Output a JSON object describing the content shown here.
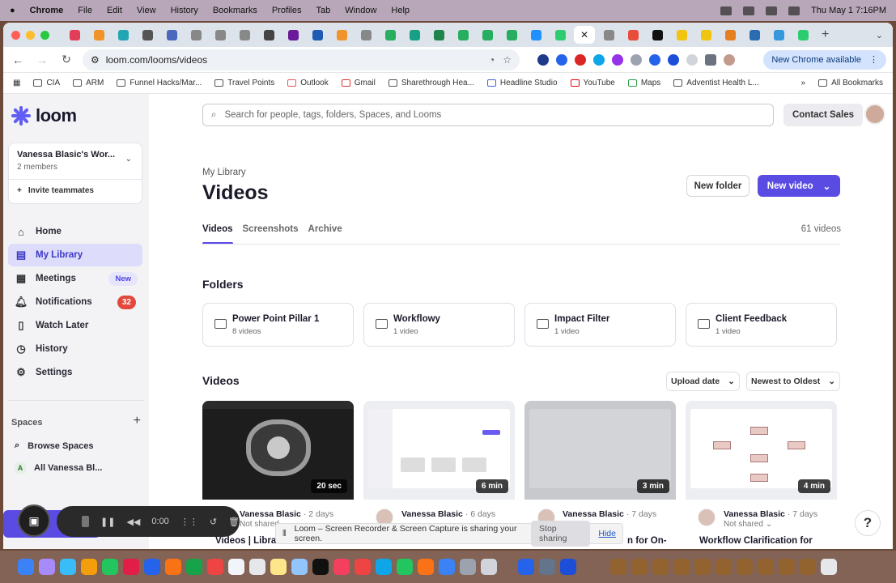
{
  "menubar": {
    "app": "Chrome",
    "items": [
      "File",
      "Edit",
      "View",
      "History",
      "Bookmarks",
      "Profiles",
      "Tab",
      "Window",
      "Help"
    ],
    "clock": "Thu May 1  7:16PM"
  },
  "browser": {
    "url": "loom.com/looms/videos",
    "new_chrome_label": "New Chrome available",
    "bookmarks": [
      "CIA",
      "ARM",
      "Funnel Hacks/Mar...",
      "Travel Points",
      "Outlook",
      "Gmail",
      "Sharethrough Hea...",
      "Headline Studio",
      "YouTube",
      "Maps",
      "Adventist Health L..."
    ],
    "all_bookmarks": "All Bookmarks"
  },
  "sidebar": {
    "logo": "loom",
    "workspace_name": "Vanessa Blasic's Wor...",
    "workspace_members": "2 members",
    "invite_label": "Invite teammates",
    "nav": [
      {
        "label": "Home",
        "icon": "home-icon"
      },
      {
        "label": "My Library",
        "icon": "library-icon"
      },
      {
        "label": "Meetings",
        "icon": "calendar-icon",
        "badge": "New"
      },
      {
        "label": "Notifications",
        "icon": "bell-icon",
        "count": "32"
      },
      {
        "label": "Watch Later",
        "icon": "bookmark-icon"
      },
      {
        "label": "History",
        "icon": "clock-icon"
      },
      {
        "label": "Settings",
        "icon": "gear-icon"
      }
    ],
    "spaces_title": "Spaces",
    "browse_spaces": "Browse Spaces",
    "space_item": "All Vanessa Bl...",
    "space_letter": "A"
  },
  "header": {
    "search_placeholder": "Search for people, tags, folders, Spaces, and Looms",
    "contact_sales": "Contact Sales"
  },
  "page": {
    "breadcrumb": "My Library",
    "title": "Videos",
    "new_folder": "New folder",
    "new_video": "New video",
    "tabs": [
      "Videos",
      "Screenshots",
      "Archive"
    ],
    "video_count": "61 videos",
    "folders_title": "Folders",
    "videos_title": "Videos",
    "sort_upload": "Upload date",
    "sort_order": "Newest to Oldest"
  },
  "folders": [
    {
      "name": "Power Point Pillar 1",
      "count": "8 videos"
    },
    {
      "name": "Workflowy",
      "count": "1 video"
    },
    {
      "name": "Impact Filter",
      "count": "1 video"
    },
    {
      "name": "Client Feedback",
      "count": "1 video"
    }
  ],
  "videos": [
    {
      "duration": "20 sec",
      "author": "Vanessa Blasic",
      "date": "· 2 days",
      "sharing": "Not shared",
      "title": "Videos | Librar"
    },
    {
      "duration": "6 min",
      "author": "Vanessa Blasic",
      "date": "· 6 days",
      "sharing": "",
      "title": ""
    },
    {
      "duration": "3 min",
      "author": "Vanessa Blasic",
      "date": "· 7 days",
      "sharing": "",
      "title": "n for On-"
    },
    {
      "duration": "4 min",
      "author": "Vanessa Blasic",
      "date": "· 7 days",
      "sharing": "Not shared ⌄",
      "title": "Workflow Clarification for"
    }
  ],
  "recorder": {
    "timer": "0:00"
  },
  "share_notice": {
    "text": "Loom – Screen Recorder & Screen Capture is sharing your screen.",
    "stop": "Stop sharing",
    "hide": "Hide"
  },
  "help_label": "?"
}
